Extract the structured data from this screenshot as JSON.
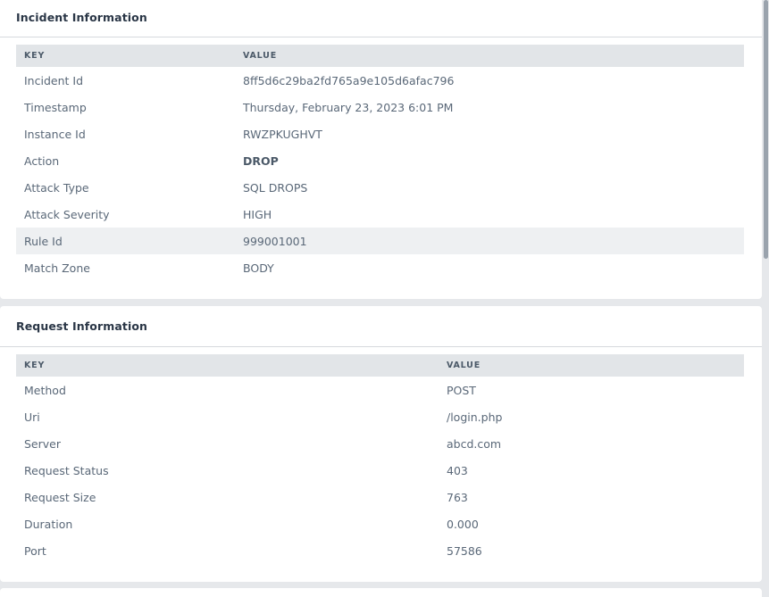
{
  "incident": {
    "title": "Incident Information",
    "headers": {
      "key": "KEY",
      "value": "VALUE"
    },
    "rows": [
      {
        "key": "Incident Id",
        "value": "8ff5d6c29ba2fd765a9e105d6afac796"
      },
      {
        "key": "Timestamp",
        "value": "Thursday, February 23, 2023 6:01 PM"
      },
      {
        "key": "Instance Id",
        "value": "RWZPKUGHVT"
      },
      {
        "key": "Action",
        "value": "DROP"
      },
      {
        "key": "Attack Type",
        "value": "SQL DROPS"
      },
      {
        "key": "Attack Severity",
        "value": "HIGH"
      },
      {
        "key": "Rule Id",
        "value": "999001001"
      },
      {
        "key": "Match Zone",
        "value": "BODY"
      }
    ]
  },
  "request": {
    "title": "Request Information",
    "headers": {
      "key": "KEY",
      "value": "VALUE"
    },
    "rows": [
      {
        "key": "Method",
        "value": "POST"
      },
      {
        "key": "Uri",
        "value": "/login.php"
      },
      {
        "key": "Server",
        "value": "abcd.com"
      },
      {
        "key": "Request Status",
        "value": "403"
      },
      {
        "key": "Request Size",
        "value": "763"
      },
      {
        "key": "Duration",
        "value": "0.000"
      },
      {
        "key": "Port",
        "value": "57586"
      }
    ]
  }
}
